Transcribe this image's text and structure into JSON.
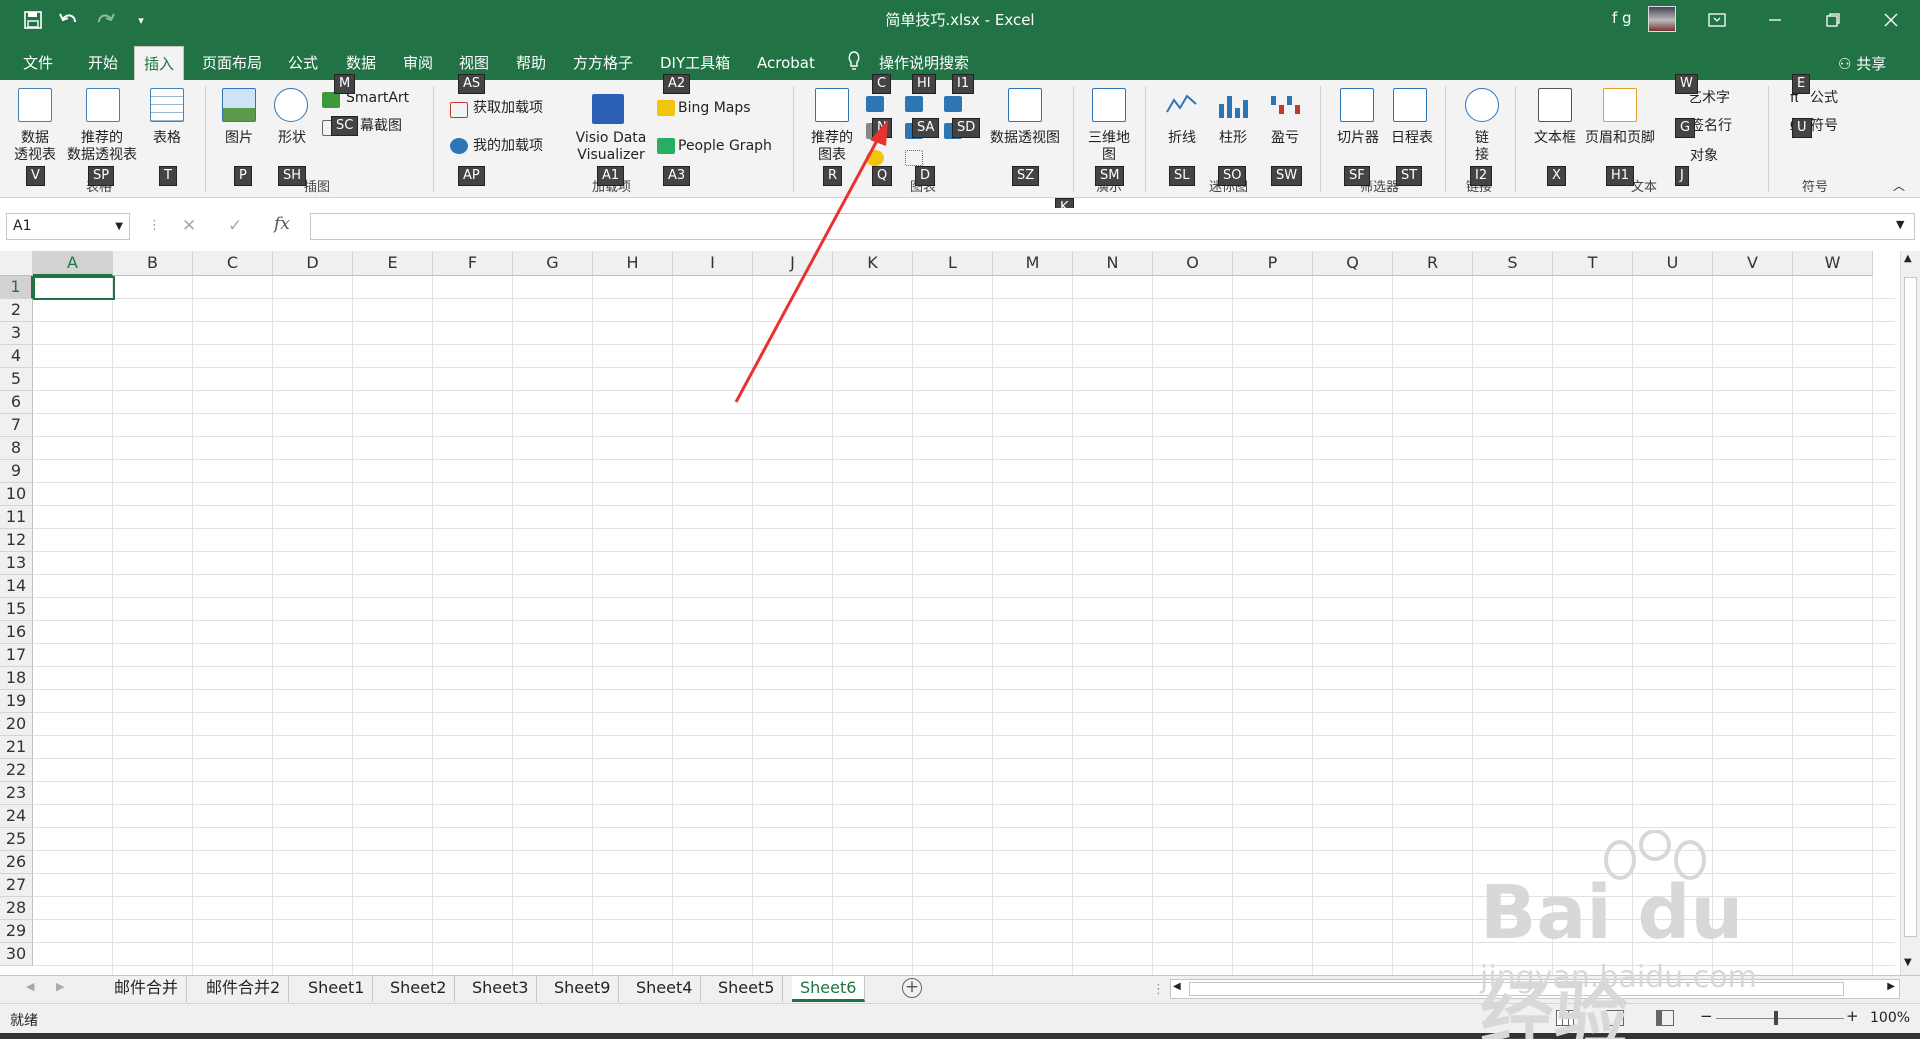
{
  "window": {
    "title": "简单技巧.xlsx  -  Excel",
    "user": "f g"
  },
  "tabs": [
    "文件",
    "开始",
    "插入",
    "页面布局",
    "公式",
    "数据",
    "审阅",
    "视图",
    "帮助",
    "方方格子",
    "DIY工具箱",
    "Acrobat"
  ],
  "active_tab": "插入",
  "tell_me": "操作说明搜索",
  "share": "共享",
  "ribbon": {
    "pivot": "数据\n透视表",
    "rec_pivot": "推荐的\n数据透视表",
    "table": "表格",
    "group_tables": "表格",
    "picture": "图片",
    "shapes": "形状",
    "smartart": "SmartArt",
    "screenshot": "幕截图",
    "group_illustrations": "插图",
    "get_addins": "获取加载项",
    "my_addins": "我的加载项",
    "visio": "Visio Data\nVisualizer",
    "bing_maps": "Bing Maps",
    "people_graph": "People Graph",
    "group_addins": "加载项",
    "rec_charts": "推荐的\n图表",
    "pivot_chart": "数据透视图",
    "group_charts": "图表",
    "map3d": "三维地\n图",
    "group_tours": "演示",
    "line": "折线",
    "column": "柱形",
    "winloss": "盈亏",
    "group_sparklines": "迷你图",
    "slicer": "切片器",
    "timeline": "日程表",
    "group_filters": "筛选器",
    "link": "链\n接",
    "group_links": "链接",
    "textbox": "文本框",
    "header_footer": "页眉和页脚",
    "wordart": "艺术字",
    "signature": "签名行",
    "object": "对象",
    "group_text": "文本",
    "equation": "公式",
    "symbol": "符号",
    "group_symbols": "符号"
  },
  "keytips": {
    "V": "V",
    "SP": "SP",
    "T": "T",
    "P": "P",
    "SH": "SH",
    "M": "M",
    "SC": "SC",
    "AS": "AS",
    "AP": "AP",
    "A1": "A1",
    "A2": "A2",
    "A3": "A3",
    "R": "R",
    "C": "C",
    "N": "N",
    "Q": "Q",
    "HI": "HI",
    "I1": "I1",
    "SA": "SA",
    "SD": "SD",
    "D": "D",
    "SZ": "SZ",
    "K": "K",
    "SM": "SM",
    "SL": "SL",
    "SO": "SO",
    "SW": "SW",
    "SF": "SF",
    "ST": "ST",
    "I2": "I2",
    "X": "X",
    "H1": "H1",
    "W": "W",
    "G": "G",
    "J": "J",
    "E": "E",
    "U": "U"
  },
  "formula_bar": {
    "name_box": "A1",
    "fx": "fx",
    "value": ""
  },
  "columns": [
    "A",
    "B",
    "C",
    "D",
    "E",
    "F",
    "G",
    "H",
    "I",
    "J",
    "K",
    "L",
    "M",
    "N",
    "O",
    "P",
    "Q",
    "R",
    "S",
    "T",
    "U",
    "V",
    "W"
  ],
  "rows": [
    "1",
    "2",
    "3",
    "4",
    "5",
    "6",
    "7",
    "8",
    "9",
    "10",
    "11",
    "12",
    "13",
    "14",
    "15",
    "16",
    "17",
    "18",
    "19",
    "20",
    "21",
    "22",
    "23",
    "24",
    "25",
    "26",
    "27",
    "28",
    "29",
    "30"
  ],
  "sheets": [
    "邮件合并",
    "邮件合并2",
    "Sheet1",
    "Sheet2",
    "Sheet3",
    "Sheet9",
    "Sheet4",
    "Sheet5",
    "Sheet6"
  ],
  "active_sheet": "Sheet6",
  "status": {
    "mode": "就绪",
    "zoom": "100%"
  },
  "watermark": {
    "brand": "Bai du 经验",
    "url": "jingyan.baidu.com"
  },
  "colors": {
    "accent": "#217346",
    "arrow": "#e8322f"
  }
}
